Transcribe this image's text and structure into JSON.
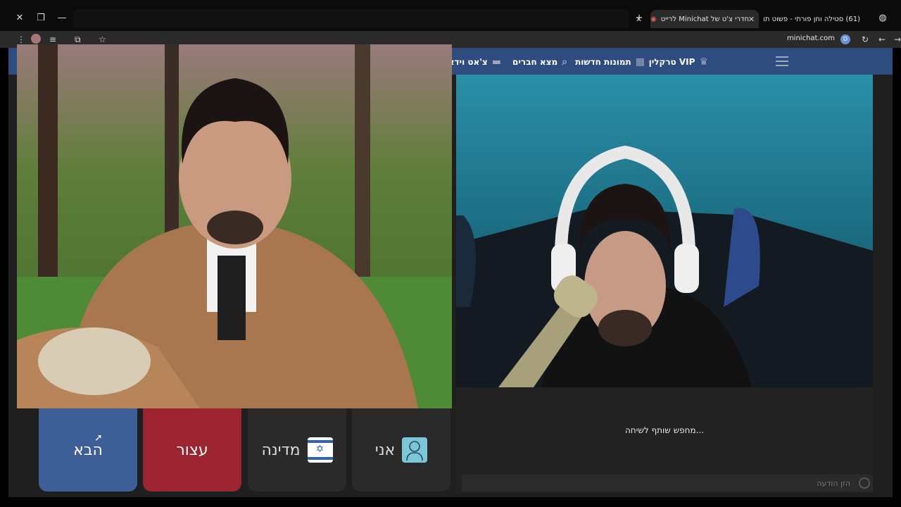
{
  "browser": {
    "tabs": [
      {
        "title": "(61) סטילה וחן פורתי - פשוט תו",
        "favicon_color": "#e0245e"
      },
      {
        "title": "חדרי צ'ט של Minichat לרייט",
        "favicon_color": "#6b8fd8",
        "recording": true
      }
    ],
    "url": "minichat.com",
    "url_badge": "D"
  },
  "header": {
    "nav": [
      {
        "label": "צ'אט וידאו",
        "icon": "video-icon"
      },
      {
        "label": "מצא חברים",
        "icon": "search-icon"
      },
      {
        "label": "תמונות חדשות",
        "icon": "grid-icon"
      },
      {
        "label": "VIP טרקלין",
        "icon": "crown-icon"
      }
    ],
    "menu_icon": "hamburger-icon"
  },
  "controls": {
    "next_label": "הבא",
    "stop_label": "עצור",
    "country_label": "מדינה",
    "me_label": "אני",
    "country_flag": "israel-flag-icon"
  },
  "chat": {
    "status": "...מחפש שותף לשיחה",
    "input_placeholder": "הזן הודעה"
  },
  "colors": {
    "header": "#2e4c7e",
    "next_button": "#3d5e96",
    "stop_button": "#9b2430"
  }
}
